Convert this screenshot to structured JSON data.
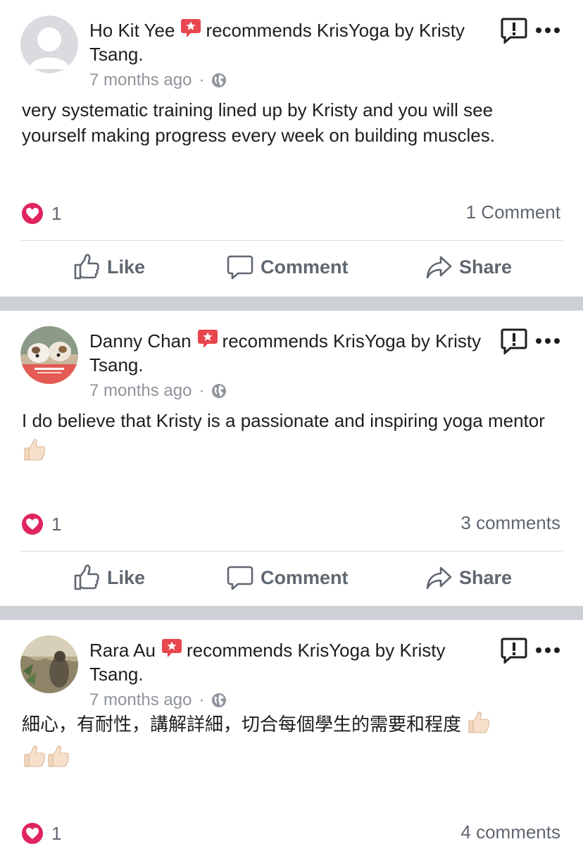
{
  "posts": [
    {
      "author": "Ho Kit Yee",
      "action": "recommends KrisYoga by Kristy Tsang.",
      "time": "7 months ago",
      "separator": "·",
      "text": "very systematic training lined up by Kristy and you will see yourself making progress every week on building muscles.",
      "reactions": "1",
      "comments": "1 Comment",
      "avatar": "default-profile-avatar"
    },
    {
      "author": "Danny Chan",
      "action": "recommends KrisYoga by Kristy Tsang.",
      "time": "7 months ago",
      "separator": "·",
      "text": "I do believe that Kristy is a passionate and inspiring yoga mentor",
      "reactions": "1",
      "comments": "3 comments",
      "avatar": "bulldogs-stay-at-home-avatar"
    },
    {
      "author": "Rara Au",
      "action": "recommends KrisYoga by Kristy Tsang.",
      "time": "7 months ago",
      "separator": "·",
      "text": "細心，有耐性，講解詳細，切合每個學生的需要和程度",
      "reactions": "1",
      "comments": "4 comments",
      "avatar": "photo-avatar"
    }
  ],
  "actions": {
    "like": "Like",
    "comment": "Comment",
    "share": "Share"
  },
  "colors": {
    "recommend_badge": "#e8474f",
    "heart": "#e0245e",
    "muted_text": "#606770",
    "meta_text": "#90949c",
    "separator": "#cdd0d4"
  }
}
